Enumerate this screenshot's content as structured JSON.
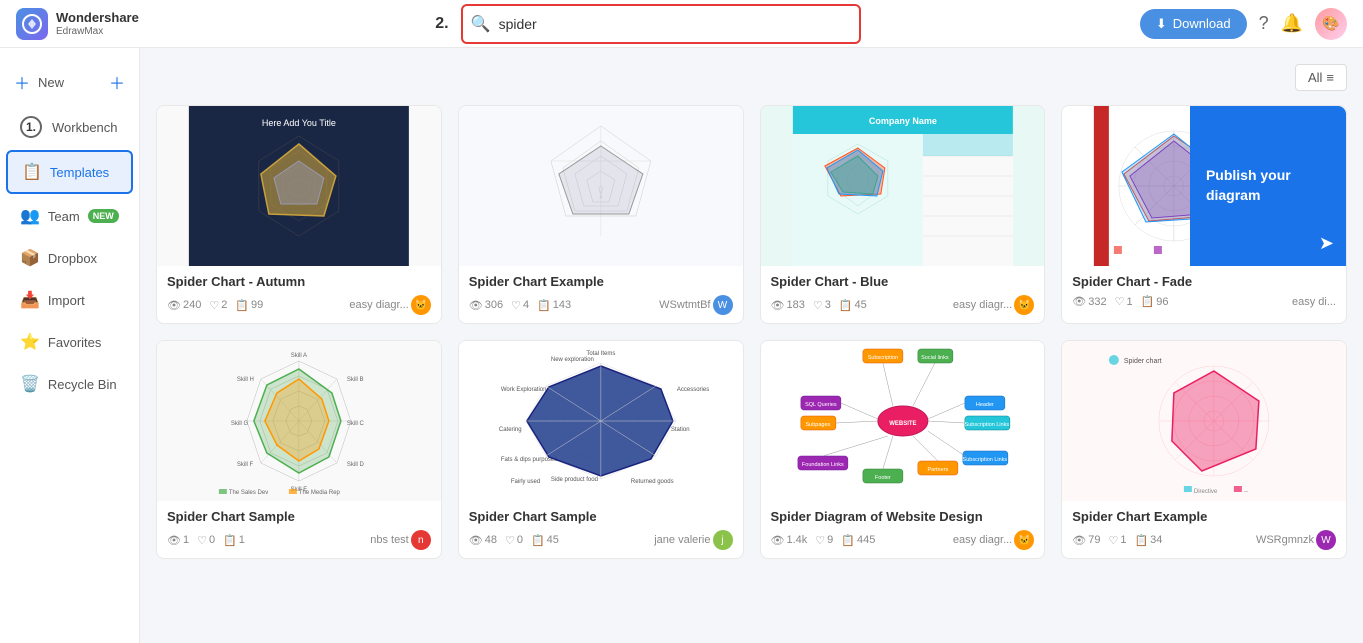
{
  "header": {
    "logo_brand": "Wondershare",
    "logo_product": "EdrawMax",
    "step2_label": "2.",
    "search_placeholder": "spider",
    "search_value": "spider",
    "download_label": "Download",
    "filter_label": "All"
  },
  "sidebar": {
    "new_label": "New",
    "items": [
      {
        "id": "workbench",
        "label": "Workbench",
        "icon": "🖥️",
        "active": false,
        "step": "1."
      },
      {
        "id": "templates",
        "label": "Templates",
        "icon": "📋",
        "active": true
      },
      {
        "id": "team",
        "label": "Team",
        "icon": "👥",
        "badge": "NEW"
      },
      {
        "id": "dropbox",
        "label": "Dropbox",
        "icon": "📦"
      },
      {
        "id": "import",
        "label": "Import",
        "icon": "📥"
      },
      {
        "id": "favorites",
        "label": "Favorites",
        "icon": "⭐"
      },
      {
        "id": "recycle",
        "label": "Recycle Bin",
        "icon": "🗑️"
      }
    ]
  },
  "cards": [
    {
      "id": "card1",
      "title": "Spider Chart - Autumn",
      "views": "240",
      "likes": "2",
      "copies": "99",
      "author": "easy diagr...",
      "author_color": "#ff9800",
      "chart_type": "autumn_spider"
    },
    {
      "id": "card2",
      "title": "Spider Chart Example",
      "views": "306",
      "likes": "4",
      "copies": "143",
      "author": "WSwtmtBf",
      "author_color": "#4a90e2",
      "chart_type": "minimal_spider"
    },
    {
      "id": "card3",
      "title": "Spider Chart - Blue",
      "views": "183",
      "likes": "3",
      "copies": "45",
      "author": "easy diagr...",
      "author_color": "#ff9800",
      "chart_type": "blue_spider"
    },
    {
      "id": "card4",
      "title": "Spider Chart - Fade",
      "views": "332",
      "likes": "1",
      "copies": "96",
      "author": "easy di...",
      "author_color": "#ff9800",
      "chart_type": "fade_spider",
      "has_publish": true
    },
    {
      "id": "card5",
      "title": "Spider Chart Sample",
      "views": "1",
      "likes": "0",
      "copies": "1",
      "author": "nbs test",
      "author_color": "#e53935",
      "chart_type": "web_spider"
    },
    {
      "id": "card6",
      "title": "Spider Chart Sample",
      "views": "48",
      "likes": "0",
      "copies": "45",
      "author": "jane valerie",
      "author_color": "#8bc34a",
      "chart_type": "filled_spider"
    },
    {
      "id": "card7",
      "title": "Spider Diagram of Website Design",
      "views": "1.4k",
      "likes": "9",
      "copies": "445",
      "author": "easy diagr...",
      "author_color": "#ff9800",
      "chart_type": "mind_spider"
    },
    {
      "id": "card8",
      "title": "Spider Chart Example",
      "views": "79",
      "likes": "1",
      "copies": "34",
      "author": "WSRgmnzk",
      "author_color": "#9c27b0",
      "chart_type": "pink_spider"
    }
  ],
  "publish_banner": {
    "title": "Publish your diagram"
  },
  "icons": {
    "search": "🔍",
    "download": "⬇",
    "views": "👁",
    "likes": "♡",
    "copies": "📋",
    "filter": "≡",
    "scroll_up": "↑"
  }
}
